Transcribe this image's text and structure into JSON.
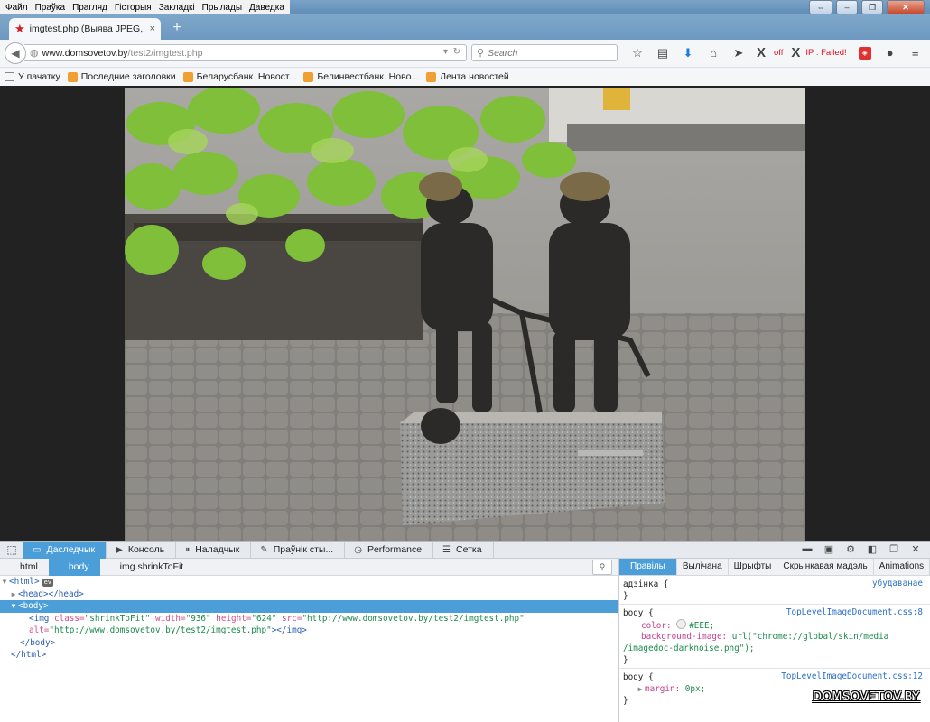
{
  "menu": [
    "Файл",
    "Праўка",
    "Прагляд",
    "Гісторыя",
    "Закладкі",
    "Прылады",
    "Даведка"
  ],
  "tab": {
    "title": "imgtest.php (Выява JPEG, ...",
    "close": "×",
    "new": "+"
  },
  "url": {
    "host": "www.domsovetov.by",
    "path": "/test2/imgtest.php"
  },
  "search": {
    "placeholder": "Search"
  },
  "toolbar": {
    "off_label": "off",
    "ip_label": "IP : Failed!"
  },
  "bookmarks": [
    "У пачатку",
    "Последние заголовки",
    "Беларусбанк. Новост...",
    "Белинвестбанк. Ново...",
    "Лента новостей"
  ],
  "devtools": {
    "tabs": [
      "Даследчык",
      "Консоль",
      "Наладчык",
      "Праўнік сты...",
      "Performance",
      "Сетка"
    ],
    "breadcrumbs": [
      "html",
      "body",
      "img.shrinkToFit"
    ]
  },
  "markup": {
    "html_open": "<html>",
    "head": "<head></head>",
    "body_open": "<body>",
    "img_tag": "img",
    "img_class": "shrinkToFit",
    "img_width": "936",
    "img_height": "624",
    "img_src": "http://www.domsovetov.by/test2/imgtest.php",
    "img_alt": "http://www.domsovetov.by/test2/imgtest.php",
    "body_close": "</body>",
    "html_close": "</html>",
    "ev_badge": "ev"
  },
  "rules_tabs": [
    "Правілы",
    "Вылічана",
    "Шрыфты",
    "Скрынкавая мадэль",
    "Animations"
  ],
  "rules": {
    "element_label": "адзінка {",
    "element_source": "убудаванае",
    "rule1_selector": "body {",
    "rule1_source": "TopLevelImageDocument.css:8",
    "rule1_color_prop": "color:",
    "rule1_color_val": "#EEE;",
    "rule1_bg_prop": "background-image:",
    "rule1_bg_val": "url(\"chrome://global/skin/media",
    "rule1_bg_val2": "/imagedoc-darknoise.png\");",
    "rule2_selector": "body {",
    "rule2_source": "TopLevelImageDocument.css:12",
    "rule2_margin_prop": "margin:",
    "rule2_margin_val": "0px;",
    "close_brace": "}"
  },
  "watermark": "DOMSOVETOV.BY"
}
